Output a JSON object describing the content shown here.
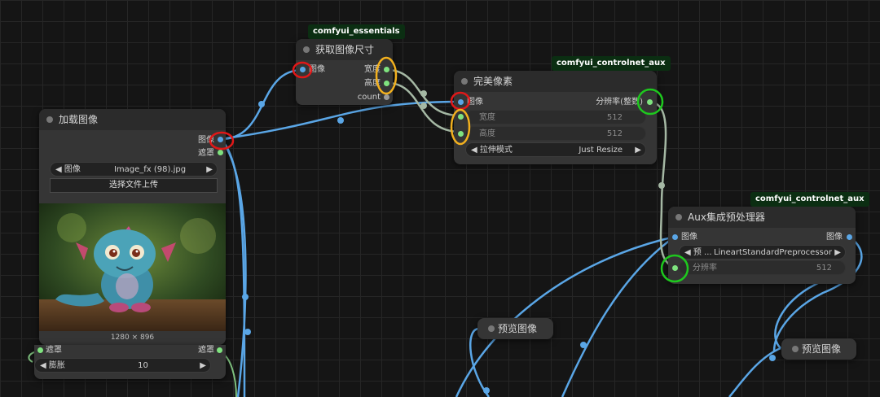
{
  "tags": {
    "essentials": "comfyui_essentials",
    "controlnet_aux_1": "comfyui_controlnet_aux",
    "controlnet_aux_2": "comfyui_controlnet_aux"
  },
  "load_image": {
    "title": "加载图像",
    "out_image": "图像",
    "out_mask": "遮罩",
    "image_label": "◀ 图像",
    "image_value": "Image_fx (98).jpg",
    "image_arrow": "▶",
    "upload_button": "选择文件上传",
    "image_size": "1280 × 896"
  },
  "get_size": {
    "title": "获取图像尺寸",
    "in_image": "图像",
    "out_width": "宽度",
    "out_height": "高度",
    "out_count": "count"
  },
  "perfect_pixel": {
    "title": "完美像素",
    "in_image": "图像",
    "out_resolution": "分辨率(整数)",
    "width_label": "宽度",
    "width_value": "512",
    "height_label": "高度",
    "height_value": "512",
    "mode_label": "◀ 拉伸模式",
    "mode_value": "Just Resize",
    "mode_arrow": "▶"
  },
  "aux_preprocessor": {
    "title": "Aux集成预处理器",
    "in_image": "图像",
    "out_image": "图像",
    "preprocessor_label": "◀ 预 ...",
    "preprocessor_value": "LineartStandardPreprocessor",
    "preprocessor_arrow": "▶",
    "resolution_label": "分辨率",
    "resolution_value": "512"
  },
  "preview_1": {
    "title": "预览图像"
  },
  "preview_2": {
    "title": "预览图像"
  },
  "partial_node": {
    "left_label": "遮罩",
    "right_label": "遮罩",
    "dilate_label": "◀ 膨胀",
    "dilate_value": "10",
    "dilate_arrow": "▶"
  },
  "colors": {
    "image_wire": "#5aa6e6",
    "int_wire": "#a5b8a4",
    "mask_wire": "#7fc27f",
    "highlight_red": "#e01818",
    "highlight_yellow": "#f2b01e",
    "highlight_green": "#1ec81e"
  }
}
